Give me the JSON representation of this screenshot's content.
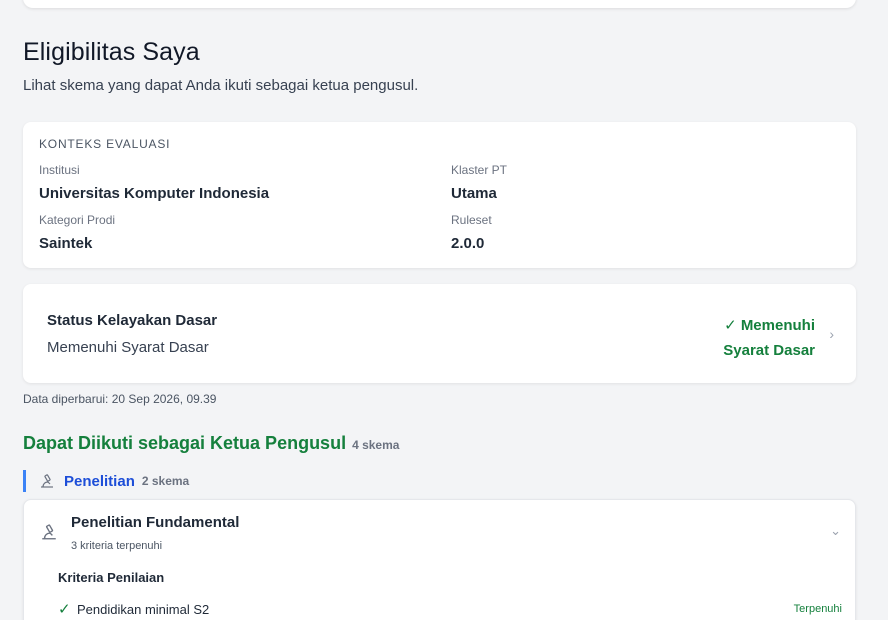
{
  "page": {
    "title": "Eligibilitas Saya",
    "subtitle": "Lihat skema yang dapat Anda ikuti sebagai ketua pengusul."
  },
  "context": {
    "heading": "KONTEKS EVALUASI",
    "institution_label": "Institusi",
    "institution_value": "Universitas Komputer Indonesia",
    "cluster_label": "Klaster PT",
    "cluster_value": "Utama",
    "category_label": "Kategori Prodi",
    "category_value": "Saintek",
    "ruleset_label": "Ruleset",
    "ruleset_value": "2.0.0"
  },
  "status": {
    "title": "Status Kelayakan Dasar",
    "subtitle": "Memenuhi Syarat Dasar",
    "badge_line1": "✓ Memenuhi",
    "badge_line2": "Syarat Dasar",
    "chevron": "›"
  },
  "updated": "Data diperbarui: 20 Sep 2026, 09.39",
  "section": {
    "title": "Dapat Diikuti sebagai Ketua Pengusul",
    "count": "4 skema"
  },
  "group": {
    "icon": "microscope-icon",
    "label": "Penelitian",
    "count": "2 skema"
  },
  "scheme": {
    "icon": "microscope-icon",
    "title": "Penelitian Fundamental",
    "subtitle": "3 kriteria terpenuhi",
    "toggle": "⌄",
    "criteria_heading": "Kriteria Penilaian",
    "criteria": [
      {
        "check": "✓",
        "text": "Pendidikan minimal S2",
        "status": "Terpenuhi"
      }
    ]
  },
  "colors": {
    "success": "#15803d",
    "accent_blue": "#1d4ed8",
    "group_border": "#3b82f6"
  }
}
